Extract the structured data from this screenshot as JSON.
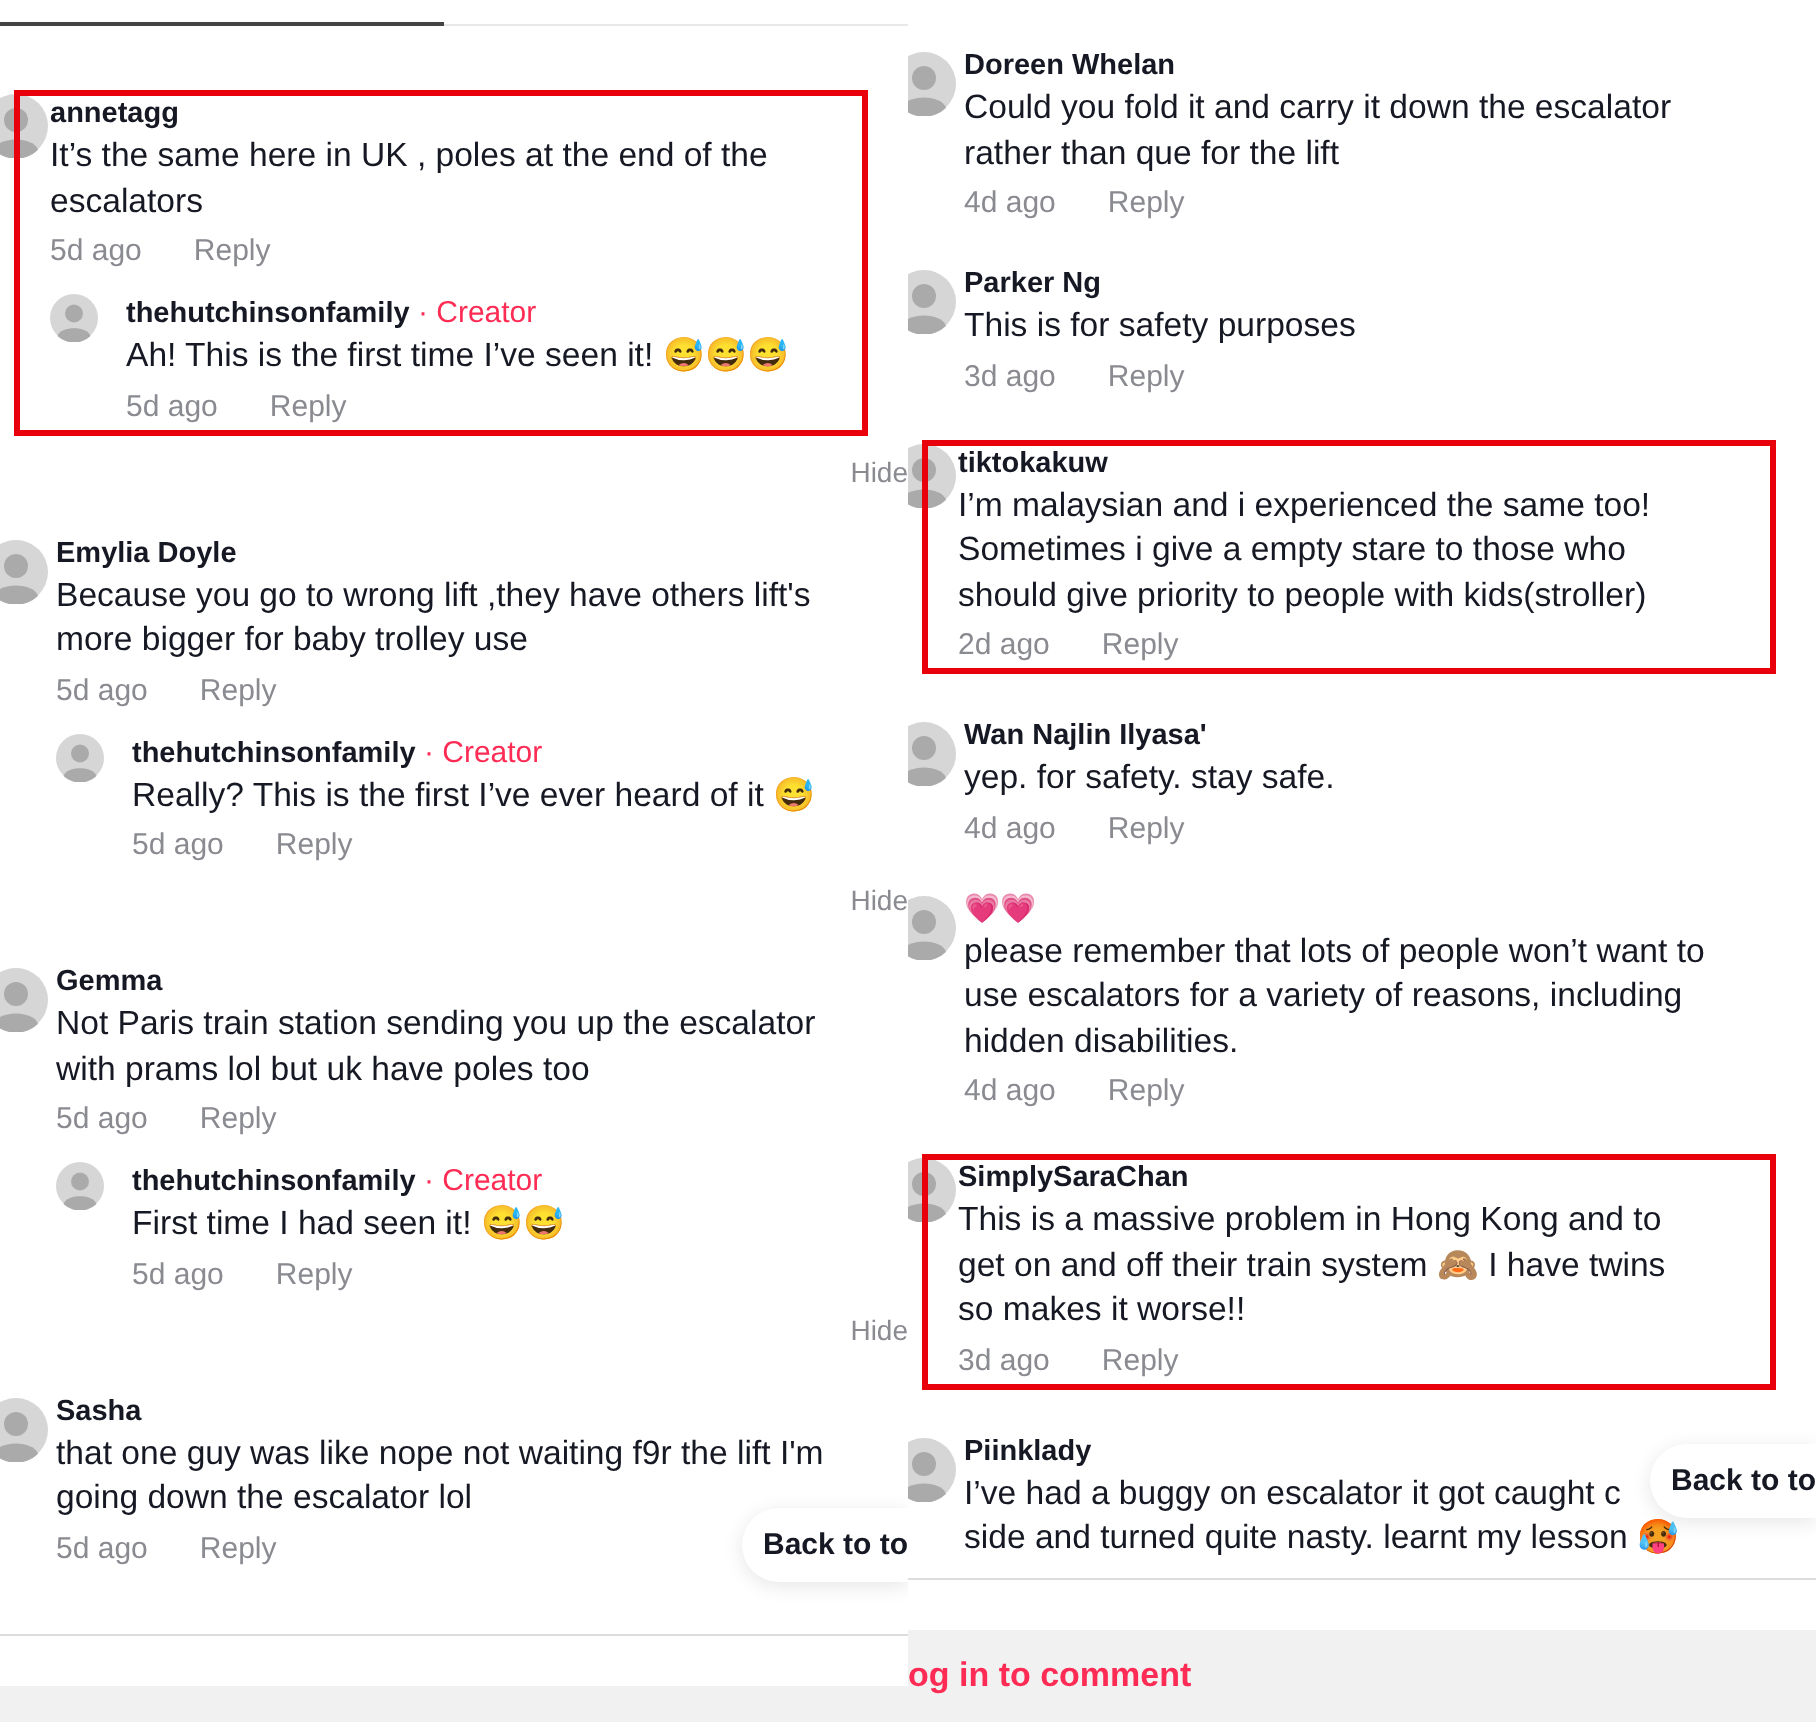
{
  "panels": [
    {
      "comments": [
        {
          "user": "annetagg",
          "text": "It’s the same here in UK , poles at the end of the escalators",
          "time": "5d ago",
          "reply": "Reply",
          "highlighted": true,
          "replies": [
            {
              "user": "thehutchinsonfamily",
              "badge": "· Creator",
              "text": "Ah! This is the first time I’ve seen it! 😅😅😅",
              "time": "5d ago",
              "reply": "Reply"
            }
          ],
          "hide": "Hide"
        },
        {
          "user": "Emylia Doyle",
          "text": "Because you go to wrong lift ,they have others lift's more bigger for baby trolley use",
          "time": "5d ago",
          "reply": "Reply",
          "highlighted": false,
          "replies": [
            {
              "user": "thehutchinsonfamily",
              "badge": "· Creator",
              "text": "Really? This is the first I’ve ever heard of it 😅",
              "time": "5d ago",
              "reply": "Reply"
            }
          ],
          "hide": "Hide"
        },
        {
          "user": "Gemma",
          "text": "Not Paris train station sending you up the escalator with prams lol but uk have poles too",
          "time": "5d ago",
          "reply": "Reply",
          "highlighted": false,
          "replies": [
            {
              "user": "thehutchinsonfamily",
              "badge": "· Creator",
              "text": "First time I had seen it! 😅😅",
              "time": "5d ago",
              "reply": "Reply"
            }
          ],
          "hide": "Hide"
        },
        {
          "user": "Sasha",
          "text": "that one guy was like nope not waiting f9r the lift I'm going down the escalator lol",
          "time": "5d ago",
          "reply": "Reply",
          "highlighted": false
        }
      ],
      "back_to_top": "Back to to"
    },
    {
      "comments": [
        {
          "user": "Doreen Whelan",
          "text": "Could you fold it and carry it down the escalator rather than que for the lift",
          "time": "4d ago",
          "reply": "Reply",
          "highlighted": false
        },
        {
          "user": "Parker Ng",
          "text": "This is for safety purposes",
          "time": "3d ago",
          "reply": "Reply",
          "highlighted": false
        },
        {
          "user": "tiktokakuw",
          "text": "I’m malaysian and i experienced the same too! Sometimes i give a empty stare to those who should give priority to people with kids(stroller)",
          "time": "2d ago",
          "reply": "Reply",
          "highlighted": true
        },
        {
          "user": "Wan Najlin Ilyasa'",
          "text": "yep. for safety. stay safe.",
          "time": "4d ago",
          "reply": "Reply",
          "highlighted": false
        },
        {
          "user": "💗💗",
          "text": "please remember that lots of people won’t want to use escalators for a variety of reasons, including hidden disabilities.",
          "time": "4d ago",
          "reply": "Reply",
          "highlighted": false
        },
        {
          "user": "SimplySaraChan",
          "text": "This is a massive problem in Hong Kong and to get on and off their train system 🙈 I have twins so makes it worse!!",
          "time": "3d ago",
          "reply": "Reply",
          "highlighted": true
        },
        {
          "user": "Piinklady",
          "lines": [
            "I’ve had a buggy on escalator it got caught c",
            "side and turned quite nasty. learnt my lesson 🥵"
          ],
          "highlighted": false
        }
      ],
      "back_to_top": "Back to to",
      "login": "og in to comment"
    }
  ]
}
